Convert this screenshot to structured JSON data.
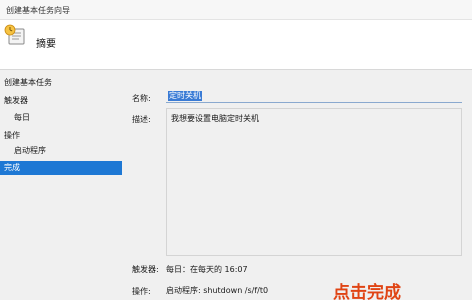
{
  "window": {
    "title": "创建基本任务向导"
  },
  "header": {
    "heading": "摘要",
    "icon": "task-wizard-icon"
  },
  "sidebar": {
    "items": [
      {
        "label": "创建基本任务",
        "selected": false
      },
      {
        "label": "触发器",
        "selected": false
      },
      {
        "label": "每日",
        "selected": false
      },
      {
        "label": "操作",
        "selected": false
      },
      {
        "label": "启动程序",
        "selected": false
      },
      {
        "label": "完成",
        "selected": true
      }
    ]
  },
  "form": {
    "name_label": "名称:",
    "name_value": "定时关机",
    "desc_label": "描述:",
    "desc_value": "我想要设置电脑定时关机"
  },
  "summary": {
    "trigger_label": "触发器:",
    "trigger_value": "每日：在每天的 16:07",
    "action_label": "操作:",
    "action_value": "启动程序: shutdown /s/f/t0"
  },
  "overlay": {
    "text": "点击完成",
    "color": "#e04414"
  },
  "colors": {
    "selection": "#1e78d4"
  }
}
